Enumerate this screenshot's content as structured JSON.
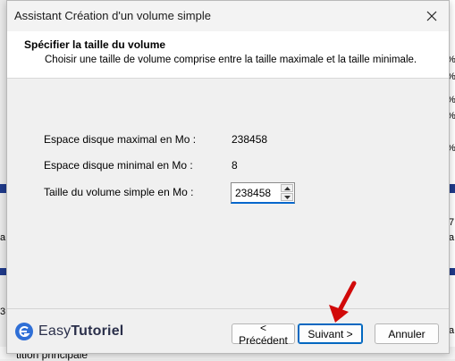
{
  "dialog": {
    "title": "Assistant Création d'un volume simple",
    "header_title": "Spécifier la taille du volume",
    "header_subtitle": "Choisir une taille de volume comprise entre la taille maximale et la taille minimale."
  },
  "fields": {
    "max_label": "Espace disque maximal en Mo :",
    "max_value": "238458",
    "min_label": "Espace disque minimal en Mo :",
    "min_value": "8",
    "size_label": "Taille du volume simple en Mo :",
    "size_value": "238458"
  },
  "buttons": {
    "previous": "< Précédent",
    "next": "Suivant >",
    "cancel": "Annuler"
  },
  "logo": {
    "word1": "Easy",
    "word2": "Tutoriel"
  },
  "background": {
    "bottom_text": "tition principale",
    "marks": [
      "%",
      "%",
      "%",
      "%",
      "%",
      "7",
      "a",
      "a",
      "a",
      "3"
    ]
  },
  "colors": {
    "accent": "#0067c0",
    "arrow": "#d10a0a",
    "background_strip": "#1f3a8a"
  }
}
